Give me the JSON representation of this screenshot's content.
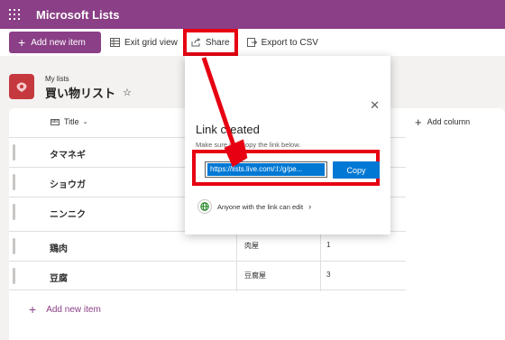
{
  "app": {
    "title": "Microsoft Lists"
  },
  "toolbar": {
    "add_new_item": "Add new item",
    "exit_grid_view": "Exit grid view",
    "share": "Share",
    "export_csv": "Export to CSV"
  },
  "list": {
    "breadcrumb": "My lists",
    "title": "買い物リスト",
    "star": "☆"
  },
  "grid": {
    "title_column": "Title",
    "add_column": "Add column",
    "rows": [
      {
        "title": "タマネギ",
        "col2": "",
        "col3": ""
      },
      {
        "title": "ショウガ",
        "col2": "",
        "col3": ""
      },
      {
        "title": "ニンニク",
        "col2": "",
        "col3": ""
      },
      {
        "title": "鶏肉",
        "col2": "肉屋",
        "col3": "1"
      },
      {
        "title": "豆腐",
        "col2": "豆腐屋",
        "col3": "3"
      }
    ],
    "add_new_item": "Add new item"
  },
  "share_panel": {
    "title": "Link created",
    "subtitle": "Make sure you copy the link below.",
    "link": "https://lists.live.com/:l:/g/pe...",
    "copy": "Copy",
    "permission": "Anyone with the link can edit",
    "close": "✕"
  },
  "colors": {
    "brand": "#8a3f86",
    "accent_blue": "#0078d4",
    "highlight_red": "#e60012",
    "list_icon": "#c5383e"
  }
}
